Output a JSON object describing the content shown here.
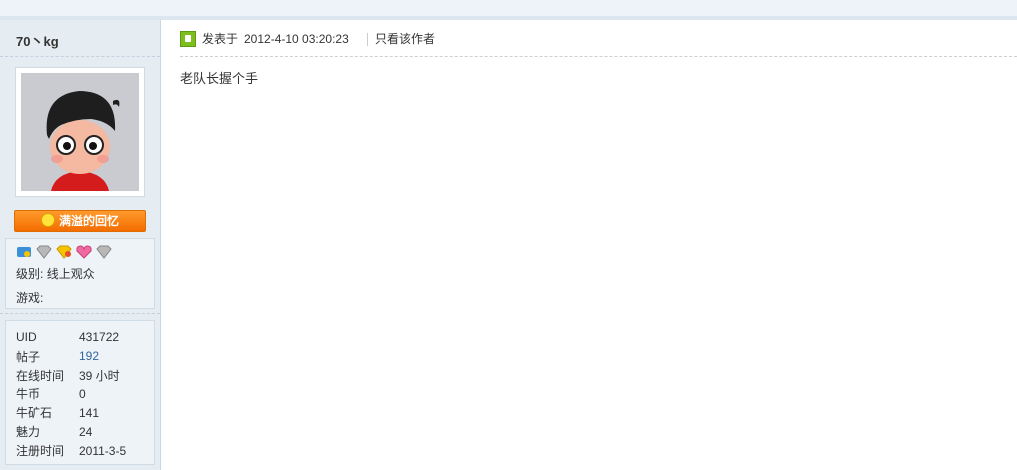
{
  "user": {
    "name": "70丶kg",
    "group": "满溢的回忆",
    "level_label": "级别:",
    "level_value": "线上观众",
    "game_label": "游戏:",
    "game_value": "",
    "medals": [
      "blue-medal-icon",
      "silver-diamond-icon",
      "gold-medal-icon",
      "pink-heart-icon",
      "silver-diamond-icon"
    ]
  },
  "stats": [
    {
      "key": "UID",
      "value": "431722"
    },
    {
      "key": "帖子",
      "value": "192"
    },
    {
      "key": "在线时间",
      "value": "39 小时"
    },
    {
      "key": "牛币",
      "value": "0"
    },
    {
      "key": "牛矿石",
      "value": "141"
    },
    {
      "key": "魅力",
      "value": "24"
    },
    {
      "key": "注册时间",
      "value": "2011-3-5"
    }
  ],
  "post": {
    "posted_label": "发表于",
    "posted_time": "2012-4-10 03:20:23",
    "only_author": "只看该作者",
    "content": "老队长握个手"
  },
  "colors": {
    "accent": "#f36c00",
    "sidebar_bg": "#e5edf2",
    "link": "#336699"
  }
}
